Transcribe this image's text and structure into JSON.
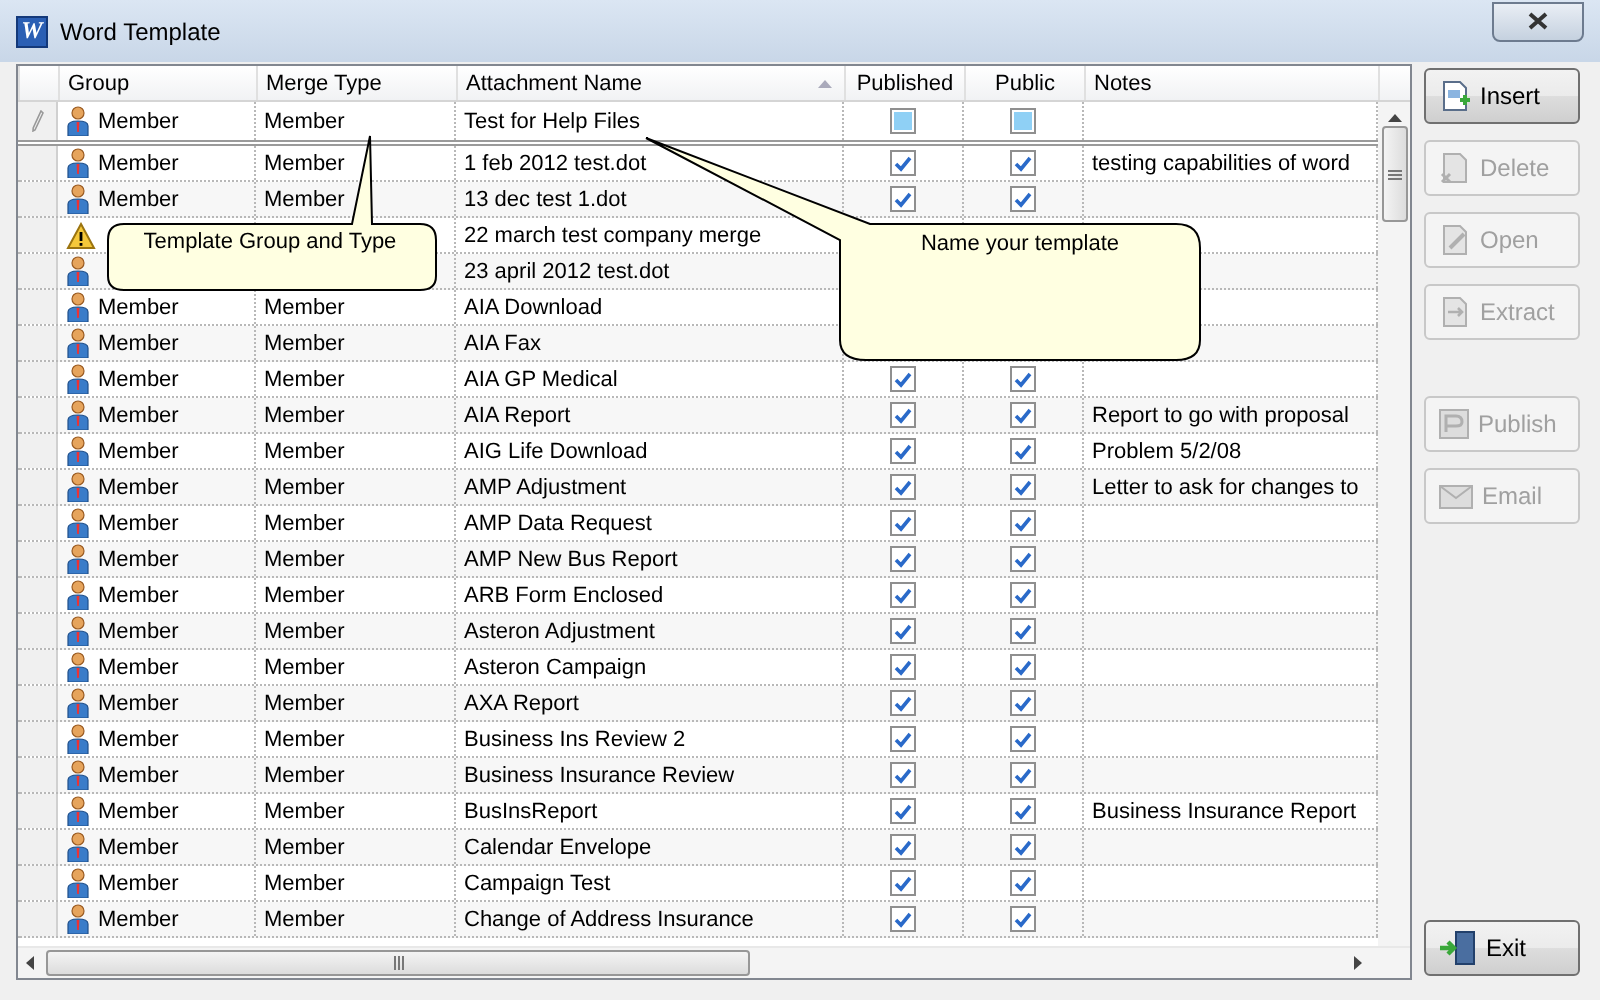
{
  "window": {
    "title": "Word Template",
    "app_icon_letter": "W"
  },
  "table": {
    "columns": [
      {
        "label": "Group",
        "sorted": false
      },
      {
        "label": "Merge Type",
        "sorted": false
      },
      {
        "label": "Attachment Name",
        "sorted": true
      },
      {
        "label": "Published",
        "sorted": false
      },
      {
        "label": "Public",
        "sorted": false
      },
      {
        "label": "Notes",
        "sorted": false
      }
    ],
    "new_row": {
      "group": "Member",
      "merge_type": "Member",
      "attachment_name": "Test for Help Files",
      "published": {
        "checked": false,
        "indeterminate": true
      },
      "public": {
        "checked": false,
        "indeterminate": true
      }
    },
    "rows": [
      {
        "kind": "member",
        "group": "Member",
        "merge_type": "Member",
        "attachment_name": "1 feb 2012 test.dot",
        "published": {
          "checked": true
        },
        "public": {
          "checked": true
        },
        "notes": "testing capabilities of word"
      },
      {
        "kind": "member",
        "group": "Member",
        "merge_type": "Member",
        "attachment_name": "13 dec test 1.dot",
        "published": {
          "checked": true
        },
        "public": {
          "checked": true
        }
      },
      {
        "kind": "warning",
        "attachment_name": "22 march test company merge"
      },
      {
        "kind": "member",
        "attachment_name": "23 april 2012 test.dot"
      },
      {
        "kind": "member",
        "group": "Member",
        "merge_type": "Member",
        "attachment_name": "AIA Download"
      },
      {
        "kind": "member",
        "group": "Member",
        "merge_type": "Member",
        "attachment_name": "AIA Fax"
      },
      {
        "kind": "member",
        "group": "Member",
        "merge_type": "Member",
        "attachment_name": "AIA GP Medical",
        "published": {
          "checked": true
        },
        "public": {
          "checked": true
        }
      },
      {
        "kind": "member",
        "group": "Member",
        "merge_type": "Member",
        "attachment_name": "AIA Report",
        "published": {
          "checked": true
        },
        "public": {
          "checked": true
        },
        "notes": "Report to go with proposal"
      },
      {
        "kind": "member",
        "group": "Member",
        "merge_type": "Member",
        "attachment_name": "AIG Life Download",
        "published": {
          "checked": true
        },
        "public": {
          "checked": true
        },
        "notes": "Problem 5/2/08"
      },
      {
        "kind": "member",
        "group": "Member",
        "merge_type": "Member",
        "attachment_name": "AMP Adjustment",
        "published": {
          "checked": true
        },
        "public": {
          "checked": true
        },
        "notes": "Letter to ask for changes to"
      },
      {
        "kind": "member",
        "group": "Member",
        "merge_type": "Member",
        "attachment_name": "AMP Data Request",
        "published": {
          "checked": true
        },
        "public": {
          "checked": true
        }
      },
      {
        "kind": "member",
        "group": "Member",
        "merge_type": "Member",
        "attachment_name": "AMP New Bus Report",
        "published": {
          "checked": true
        },
        "public": {
          "checked": true
        }
      },
      {
        "kind": "member",
        "group": "Member",
        "merge_type": "Member",
        "attachment_name": "ARB Form Enclosed",
        "published": {
          "checked": true
        },
        "public": {
          "checked": true
        }
      },
      {
        "kind": "member",
        "group": "Member",
        "merge_type": "Member",
        "attachment_name": "Asteron Adjustment",
        "published": {
          "checked": true
        },
        "public": {
          "checked": true
        }
      },
      {
        "kind": "member",
        "group": "Member",
        "merge_type": "Member",
        "attachment_name": "Asteron Campaign",
        "published": {
          "checked": true
        },
        "public": {
          "checked": true
        }
      },
      {
        "kind": "member",
        "group": "Member",
        "merge_type": "Member",
        "attachment_name": "AXA Report",
        "published": {
          "checked": true
        },
        "public": {
          "checked": true
        }
      },
      {
        "kind": "member",
        "group": "Member",
        "merge_type": "Member",
        "attachment_name": "Business Ins Review 2",
        "published": {
          "checked": true
        },
        "public": {
          "checked": true
        }
      },
      {
        "kind": "member",
        "group": "Member",
        "merge_type": "Member",
        "attachment_name": "Business Insurance Review",
        "published": {
          "checked": true
        },
        "public": {
          "checked": true
        }
      },
      {
        "kind": "member",
        "group": "Member",
        "merge_type": "Member",
        "attachment_name": "BusInsReport",
        "published": {
          "checked": true
        },
        "public": {
          "checked": true
        },
        "notes": "Business Insurance Report"
      },
      {
        "kind": "member",
        "group": "Member",
        "merge_type": "Member",
        "attachment_name": "Calendar Envelope",
        "published": {
          "checked": true
        },
        "public": {
          "checked": true
        }
      },
      {
        "kind": "member",
        "group": "Member",
        "merge_type": "Member",
        "attachment_name": "Campaign Test",
        "published": {
          "checked": true
        },
        "public": {
          "checked": true
        }
      },
      {
        "kind": "member",
        "group": "Member",
        "merge_type": "Member",
        "attachment_name": "Change of Address Insurance",
        "published": {
          "checked": true
        },
        "public": {
          "checked": true
        }
      }
    ]
  },
  "callouts": [
    {
      "text": "Template Group and Type"
    },
    {
      "text": "Name your template"
    }
  ],
  "buttons": [
    {
      "label": "Insert",
      "kind": "insert",
      "disabled": false
    },
    {
      "label": "Delete",
      "kind": "delete",
      "disabled": true
    },
    {
      "label": "Open",
      "kind": "open",
      "disabled": true
    },
    {
      "label": "Extract",
      "kind": "extract",
      "disabled": true
    },
    {
      "label": "Publish",
      "kind": "publish",
      "disabled": true
    },
    {
      "label": "Email",
      "kind": "email",
      "disabled": true
    },
    {
      "label": "Exit",
      "kind": "exit",
      "disabled": false
    }
  ]
}
